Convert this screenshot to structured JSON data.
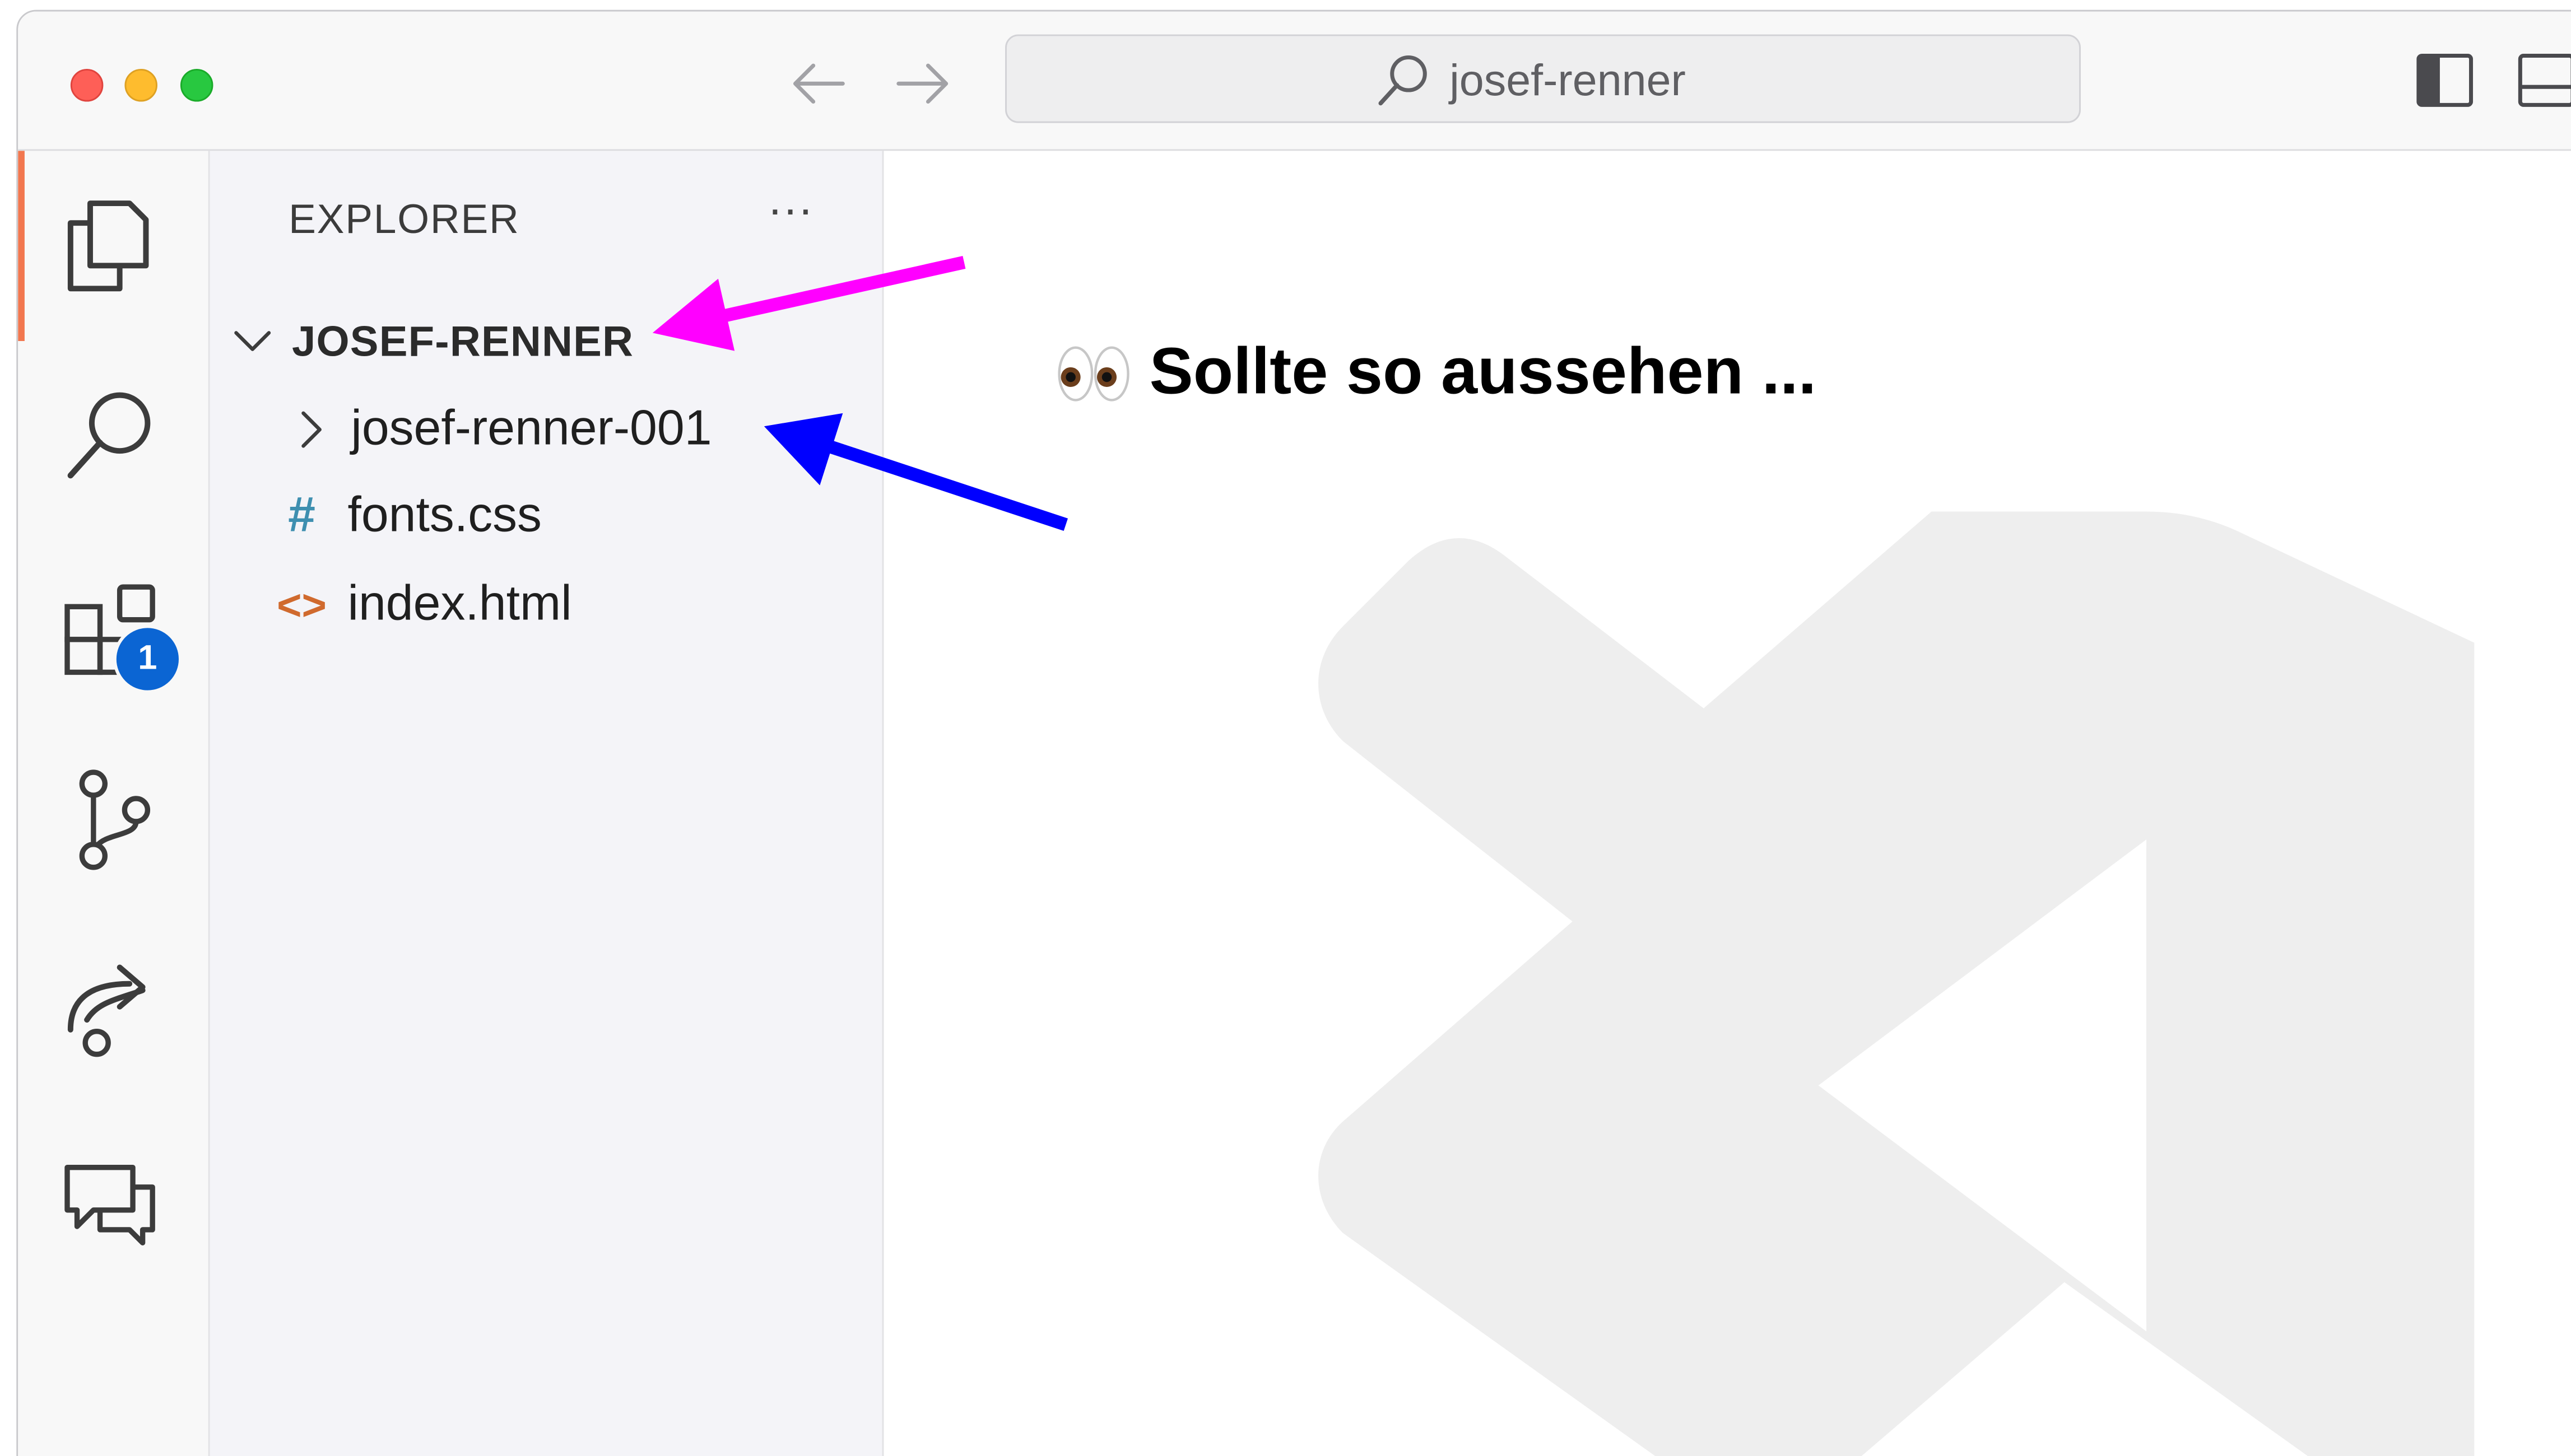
{
  "window": {
    "search": {
      "text": "josef-renner"
    }
  },
  "activity_bar": {
    "items": [
      {
        "name": "explorer",
        "icon": "files-icon",
        "active": true
      },
      {
        "name": "search",
        "icon": "search-icon"
      },
      {
        "name": "extensions",
        "icon": "extensions-icon",
        "badge": "1"
      },
      {
        "name": "source-control",
        "icon": "source-control-icon"
      },
      {
        "name": "remote",
        "icon": "remote-explorer-icon"
      },
      {
        "name": "chat",
        "icon": "comments-icon"
      }
    ],
    "active_color": "#f2774f",
    "badge_color": "#0b65d3"
  },
  "sidebar": {
    "title": "EXPLORER",
    "more_label": "···",
    "root": {
      "label": "JOSEF-RENNER",
      "expanded": true
    },
    "tree": [
      {
        "type": "folder",
        "label": "josef-renner-001",
        "expanded": false
      },
      {
        "type": "file",
        "label": "fonts.css",
        "icon": "#",
        "icon_color": "#3e8fb0"
      },
      {
        "type": "file",
        "label": "index.html",
        "icon": "<>",
        "icon_color": "#d06a2e"
      }
    ]
  },
  "editor": {
    "annotation_text": "Sollte so aussehen ...",
    "annotation_emoji": "eyes-icon",
    "arrow_colors": {
      "root_arrow": "#ff00ff",
      "folder_arrow": "#0000ff"
    }
  }
}
